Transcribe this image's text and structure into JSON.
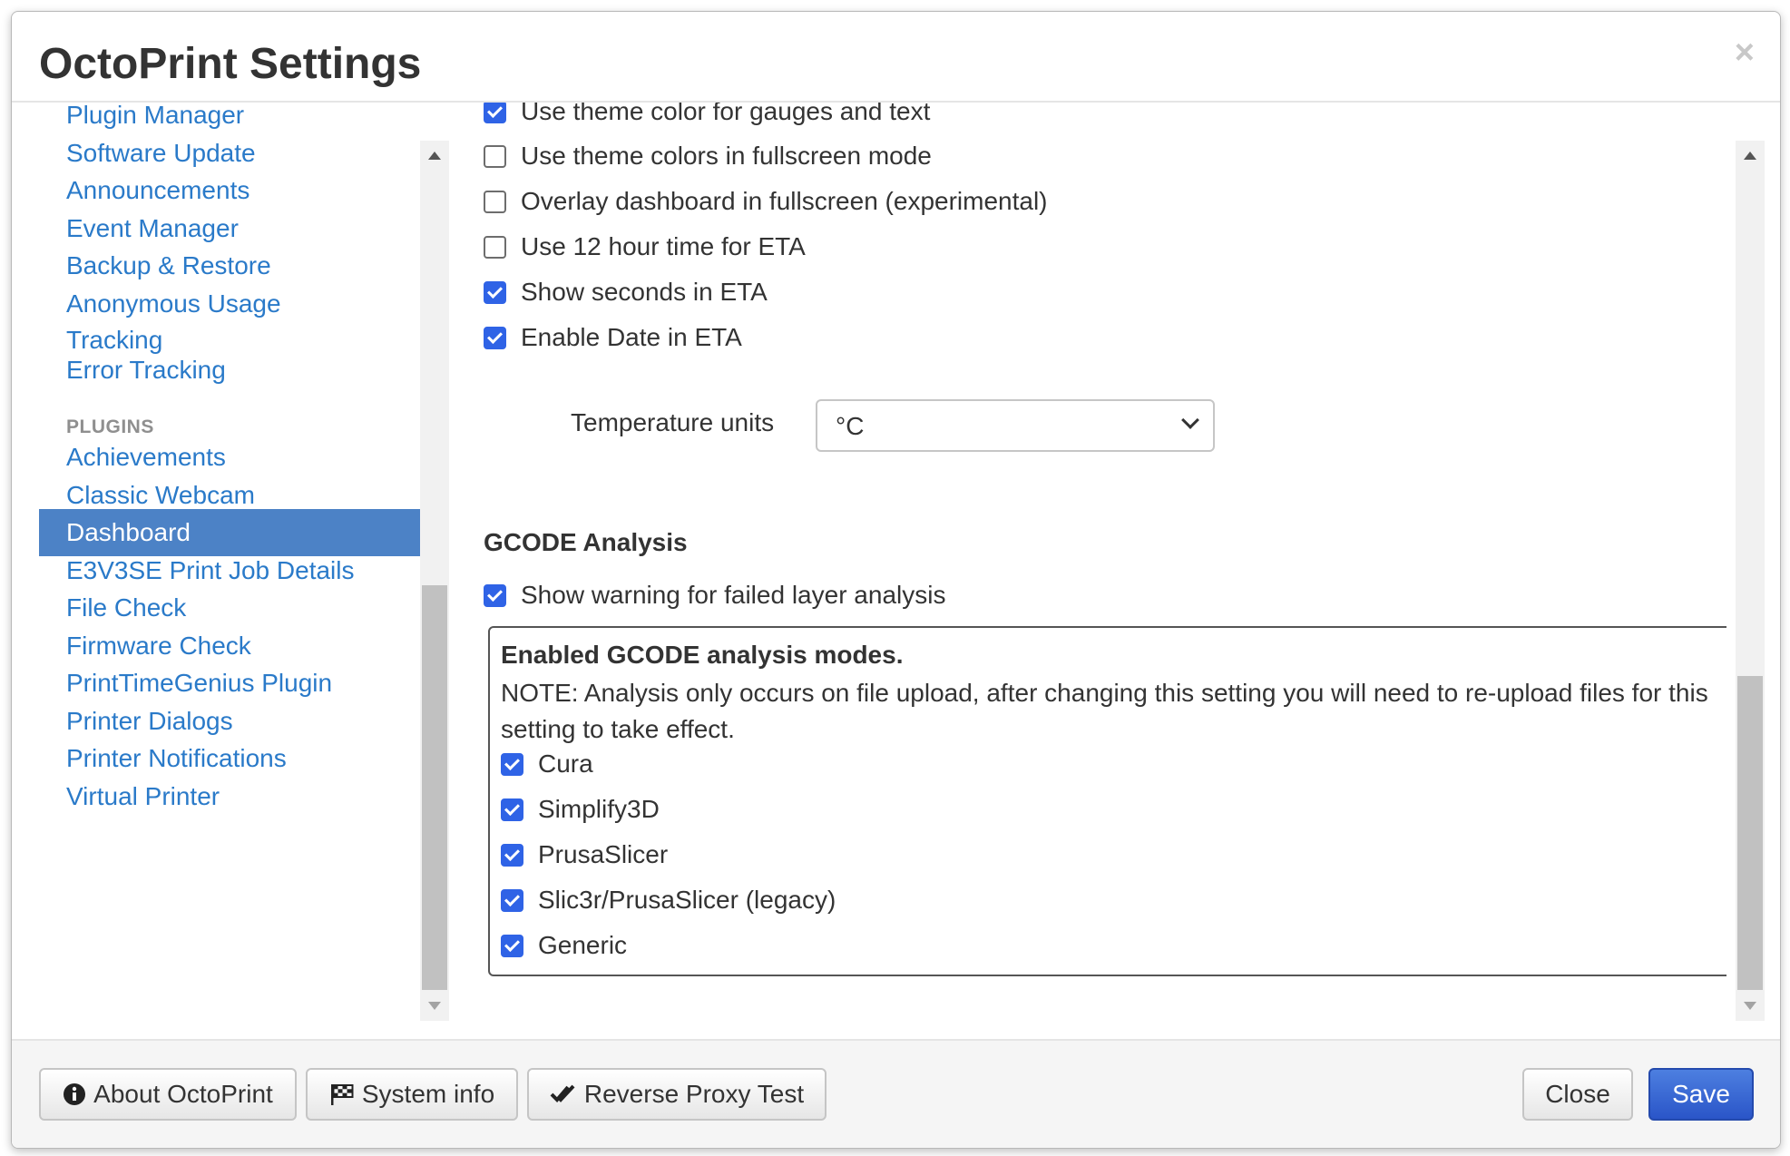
{
  "modal": {
    "title": "OctoPrint Settings",
    "close_symbol": "×"
  },
  "sidebar": {
    "items_top": [
      {
        "label": "Plugin Manager"
      },
      {
        "label": "Software Update"
      },
      {
        "label": "Announcements"
      },
      {
        "label": "Event Manager"
      },
      {
        "label": "Backup & Restore"
      },
      {
        "label": "Anonymous Usage Tracking"
      },
      {
        "label": "Error Tracking"
      }
    ],
    "plugins_header": "PLUGINS",
    "plugins": [
      {
        "label": "Achievements"
      },
      {
        "label": "Classic Webcam"
      },
      {
        "label": "Dashboard",
        "active": true
      },
      {
        "label": "E3V3SE Print Job Details"
      },
      {
        "label": "File Check"
      },
      {
        "label": "Firmware Check"
      },
      {
        "label": "PrintTimeGenius Plugin"
      },
      {
        "label": "Printer Dialogs"
      },
      {
        "label": "Printer Notifications"
      },
      {
        "label": "Virtual Printer"
      }
    ]
  },
  "dashboard": {
    "checkboxes": [
      {
        "label": "Use theme color for gauges and text",
        "checked": true
      },
      {
        "label": "Use theme colors in fullscreen mode",
        "checked": false
      },
      {
        "label": "Overlay dashboard in fullscreen (experimental)",
        "checked": false
      },
      {
        "label": "Use 12 hour time for ETA",
        "checked": false
      },
      {
        "label": "Show seconds in ETA",
        "checked": true
      },
      {
        "label": "Enable Date in ETA",
        "checked": true
      }
    ],
    "temperature_units": {
      "label": "Temperature units",
      "value": "°C"
    },
    "gcode_section": {
      "title": "GCODE Analysis",
      "warning": {
        "label": "Show warning for failed layer analysis",
        "checked": true
      },
      "box_heading": "Enabled GCODE analysis modes.",
      "box_note": "NOTE: Analysis only occurs on file upload, after changing this setting you will need to re-upload files for this setting to take effect.",
      "modes": [
        {
          "label": "Cura",
          "checked": true
        },
        {
          "label": "Simplify3D",
          "checked": true
        },
        {
          "label": "PrusaSlicer",
          "checked": true
        },
        {
          "label": "Slic3r/PrusaSlicer (legacy)",
          "checked": true
        },
        {
          "label": "Generic",
          "checked": true
        }
      ]
    }
  },
  "footer": {
    "about_label": "About OctoPrint",
    "system_info_label": "System info",
    "reverse_proxy_label": "Reverse Proxy Test",
    "close_label": "Close",
    "save_label": "Save"
  },
  "colors": {
    "link": "#2a7ac9",
    "active_bg": "#4c82c6",
    "checkbox": "#2f63e6",
    "save_button": "#2a55c8"
  }
}
